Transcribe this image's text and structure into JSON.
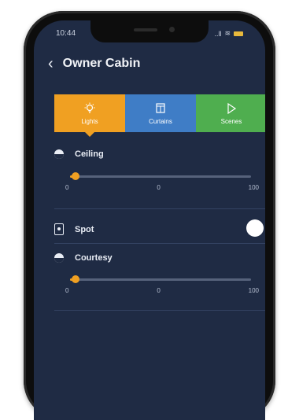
{
  "status_bar": {
    "time": "10:44",
    "signal": "..ll",
    "wifi": "≋"
  },
  "header": {
    "back_icon": "chevron-left-icon",
    "title": "Owner Cabin"
  },
  "tabs": [
    {
      "label": "Lights",
      "icon": "bulb-icon",
      "color": "#f0a022",
      "selected": true
    },
    {
      "label": "Curtains",
      "icon": "curtain-icon",
      "color": "#3f7dc6",
      "selected": false
    },
    {
      "label": "Scenes",
      "icon": "play-icon",
      "color": "#4fae4f",
      "selected": false
    }
  ],
  "controls": {
    "ceiling": {
      "label": "Ceiling",
      "value": 3,
      "min_label": "0",
      "mid_label": "0",
      "max_label": "100"
    },
    "spot": {
      "label": "Spot",
      "on": false
    },
    "courtesy": {
      "label": "Courtesy",
      "value": 3,
      "min_label": "0",
      "mid_label": "0",
      "max_label": "100"
    }
  },
  "colors": {
    "background": "#1f2b44",
    "accent": "#f0a022"
  }
}
